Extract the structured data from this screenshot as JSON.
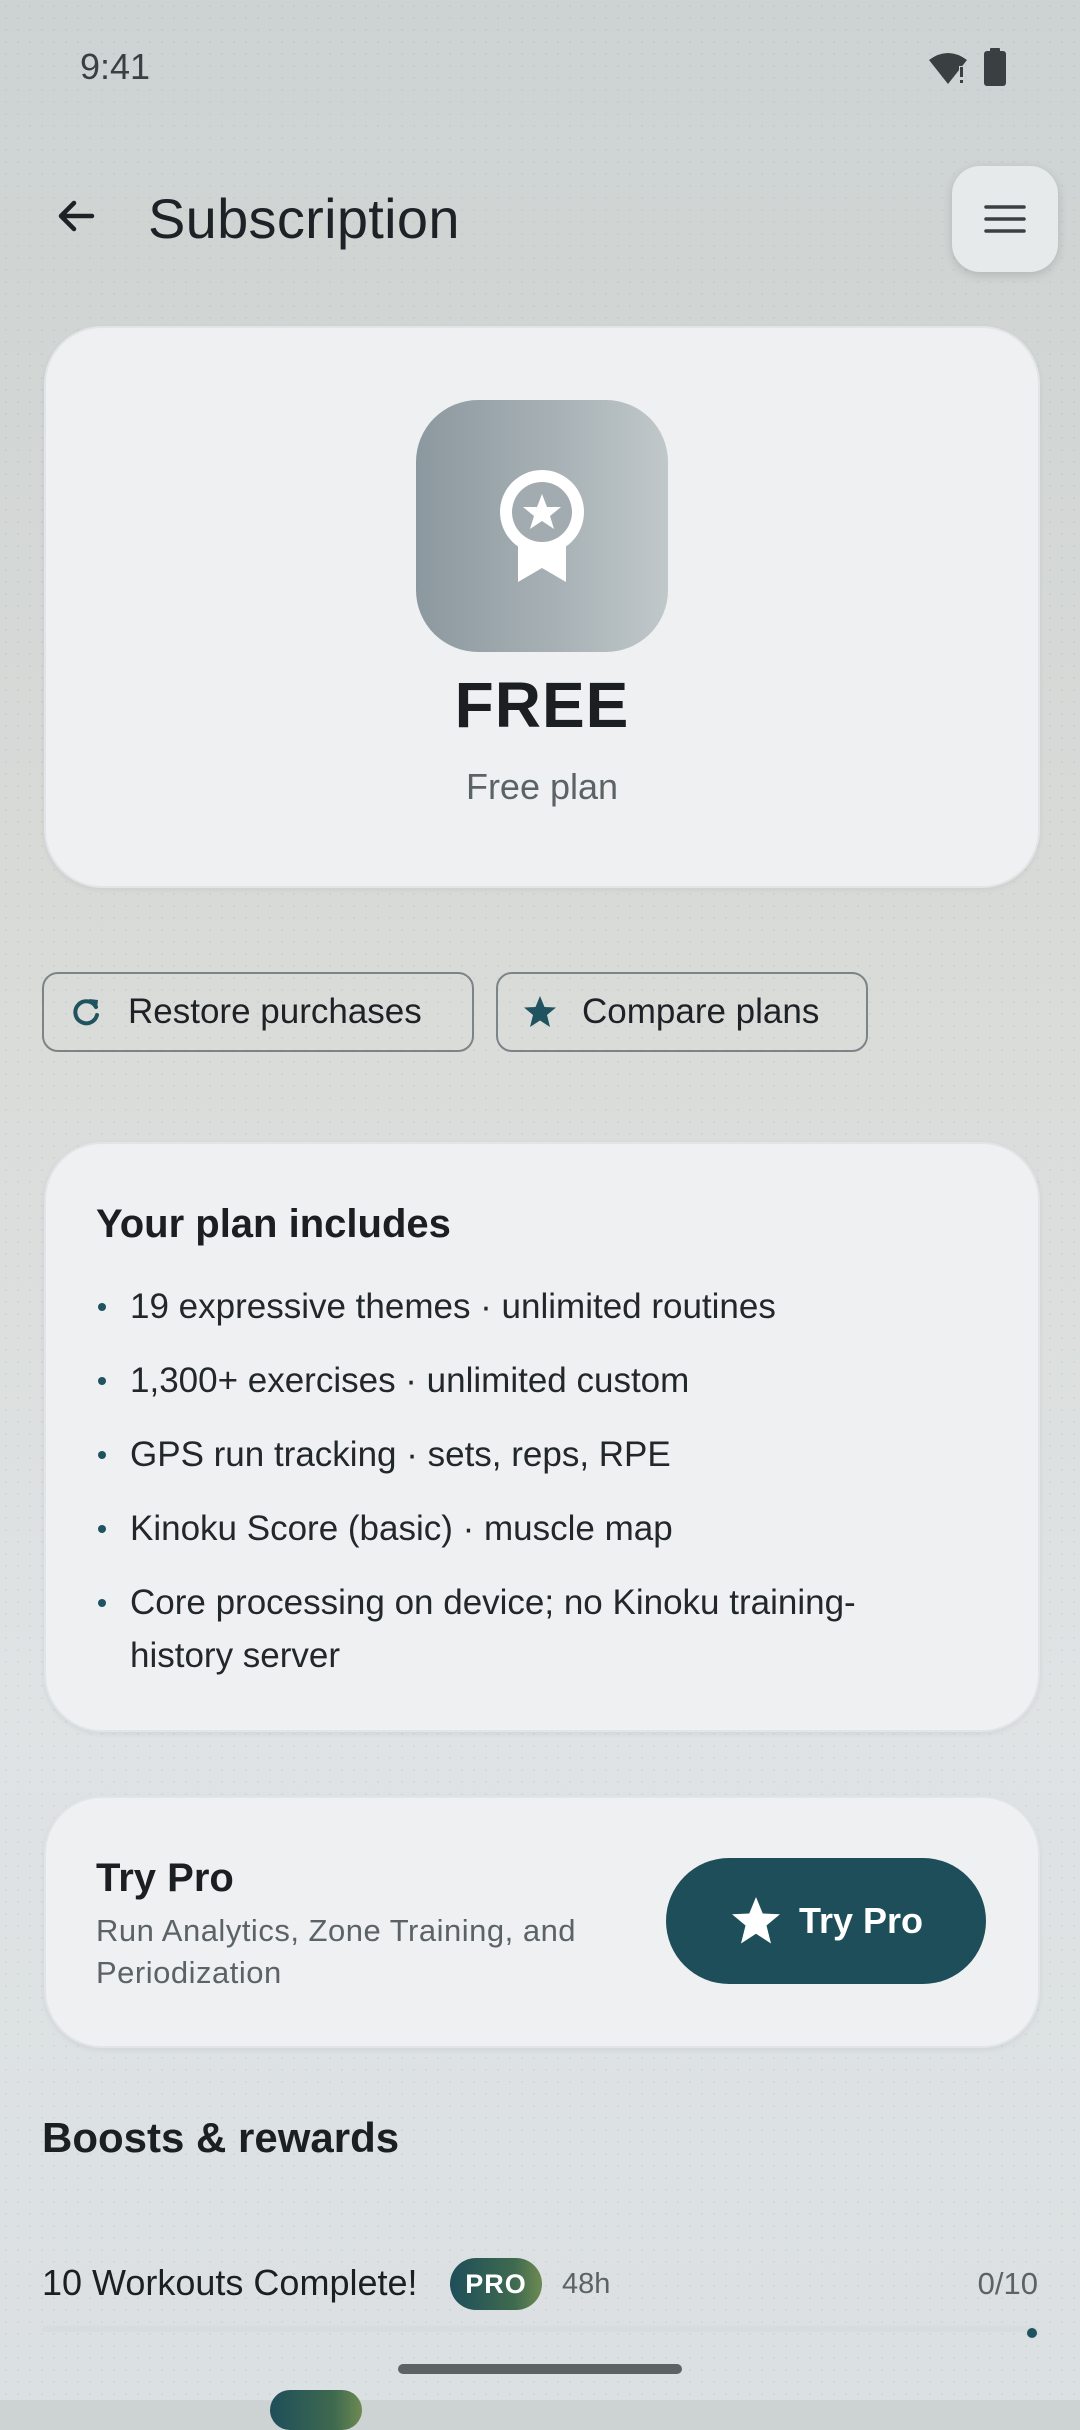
{
  "status_bar": {
    "time": "9:41",
    "icons": [
      "wifi-alert-icon",
      "battery-icon"
    ]
  },
  "app_bar": {
    "title": "Subscription",
    "back_icon": "arrow-back-icon",
    "menu_icon": "menu-icon"
  },
  "plan": {
    "badge_icon": "award-ribbon-icon",
    "name": "FREE",
    "subtitle": "Free plan"
  },
  "actions": {
    "restore": {
      "label": "Restore purchases",
      "icon": "refresh-icon"
    },
    "compare": {
      "label": "Compare plans",
      "icon": "star-icon"
    }
  },
  "features": {
    "title": "Your plan includes",
    "items": [
      "19 expressive themes · unlimited routines",
      "1,300+ exercises · unlimited custom",
      "GPS run tracking · sets, reps, RPE",
      "Kinoku Score (basic) · muscle map",
      "Core processing on device; no Kinoku training-history server"
    ]
  },
  "pro": {
    "title": "Try Pro",
    "description": "Run Analytics, Zone Training, and Periodization",
    "button_label": "Try Pro",
    "button_icon": "star-icon"
  },
  "boosts": {
    "title": "Boosts & rewards",
    "items": [
      {
        "title": "10 Workouts Complete!",
        "badge": "PRO",
        "time": "48h",
        "progress": "0/10",
        "progress_fraction": 0
      }
    ]
  },
  "colors": {
    "accent": "#1e4e5a",
    "card": "#eef0f2",
    "text_primary": "#1b1f22",
    "text_secondary": "#5b6367"
  }
}
